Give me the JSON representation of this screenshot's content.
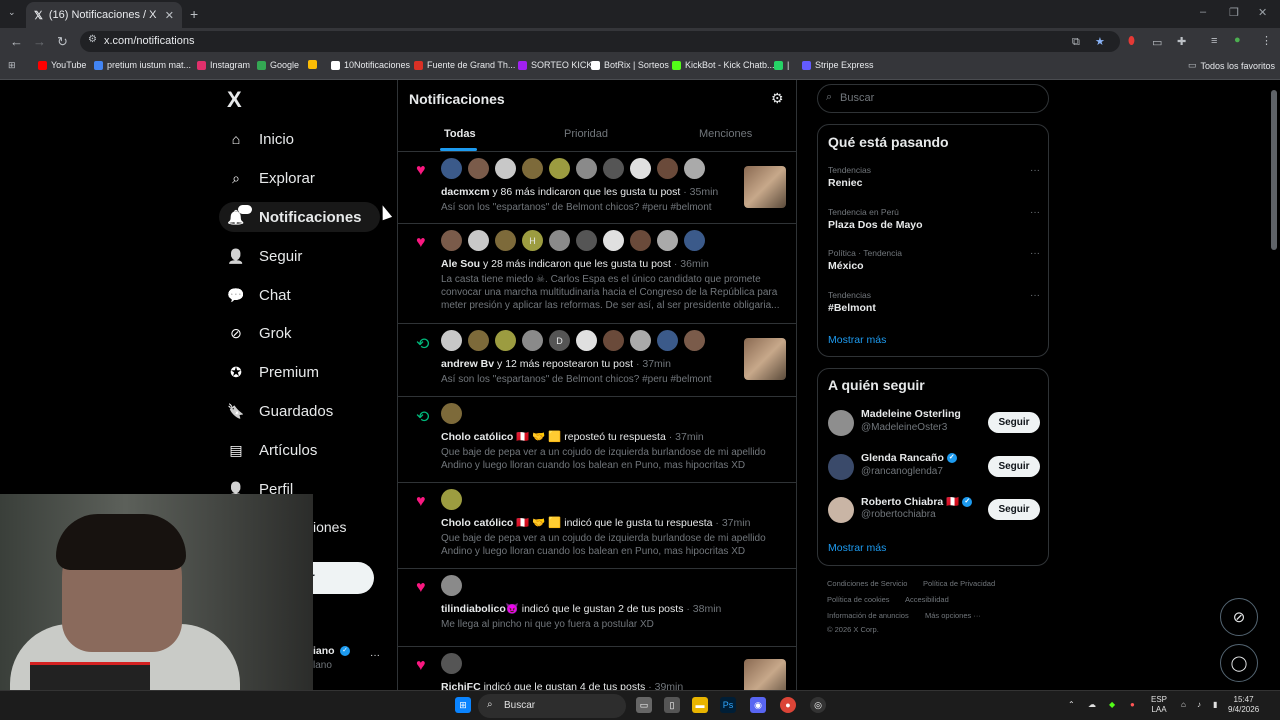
{
  "browser": {
    "tab_title": "(16) Notificaciones / X",
    "url": "x.com/notifications",
    "bookmarks": [
      {
        "label": "YouTube",
        "color": "#ff0000"
      },
      {
        "label": "pretium iustum mat...",
        "color": "#4285f4"
      },
      {
        "label": "Instagram",
        "color": "#e1306c"
      },
      {
        "label": "Google",
        "color": "#34a853"
      },
      {
        "label": "",
        "color": "#fbbc05"
      },
      {
        "label": "10Notificaciones",
        "color": "#ffffff"
      },
      {
        "label": "Fuente de Grand Th...",
        "color": "#d93025"
      },
      {
        "label": "SORTEO KICK",
        "color": "#a020f0"
      },
      {
        "label": "BotRix | Sorteos",
        "color": "#ffffff"
      },
      {
        "label": "KickBot - Kick Chatb...",
        "color": "#53fc18"
      },
      {
        "label": "|",
        "color": "#25d366"
      },
      {
        "label": "Stripe Express",
        "color": "#635bff"
      }
    ],
    "all_bookmarks": "Todos los favoritos"
  },
  "sidebar": {
    "logo": "X",
    "items": [
      {
        "label": "Inicio",
        "icon": "home-icon"
      },
      {
        "label": "Explorar",
        "icon": "search-icon"
      },
      {
        "label": "Notificaciones",
        "icon": "bell-icon",
        "badge": "16"
      },
      {
        "label": "Seguir",
        "icon": "add-person-icon"
      },
      {
        "label": "Chat",
        "icon": "chat-icon"
      },
      {
        "label": "Grok",
        "icon": "grok-icon"
      },
      {
        "label": "Premium",
        "icon": "premium-icon"
      },
      {
        "label": "Guardados",
        "icon": "bookmark-icon"
      },
      {
        "label": "Artículos",
        "icon": "articles-icon"
      },
      {
        "label": "Perfil",
        "icon": "person-icon"
      }
    ],
    "partial_more": "iones",
    "partial_post": "r",
    "partial_name": "iano",
    "partial_handle": "lano",
    "more_dots": "···"
  },
  "main": {
    "title": "Notificaciones",
    "tabs": [
      "Todas",
      "Prioridad",
      "Menciones"
    ],
    "notifications": [
      {
        "kind": "like",
        "avatars": [
          "",
          "",
          "",
          "",
          "",
          "",
          "",
          "",
          "",
          ""
        ],
        "actor": "dacmxcm",
        "action": " y 86 más indicaron que les gusta tu post",
        "time": " · 35min",
        "text": "Así son los \"espartanos\" de Belmont chicos? #peru #belmont",
        "thumb": true
      },
      {
        "kind": "like",
        "avatars": [
          "",
          "",
          "",
          "H",
          "",
          "",
          "",
          "",
          "",
          ""
        ],
        "actor": "Ale Sou",
        "action": " y 28 más indicaron que les gusta tu post",
        "time": " · 36min",
        "text": "La casta tiene miedo ☠. Carlos Espa es el único candidato que promete convocar una marcha multitudinaria hacia el Congreso de la República para meter presión y aplicar las reformas. De ser así, al ser presidente obligaria...",
        "thumb": false
      },
      {
        "kind": "repost",
        "avatars": [
          "",
          "",
          "",
          "",
          "D",
          "",
          "",
          "",
          "",
          ""
        ],
        "actor": "andrew Bv",
        "action": " y 12 más repostearon tu post",
        "time": " · 37min",
        "text": "Así son los \"espartanos\" de Belmont chicos? #peru #belmont",
        "thumb": true
      },
      {
        "kind": "repost",
        "avatars": [
          ""
        ],
        "actor": "Cholo católico",
        "action": " 🇵🇪 🤝 🟨 reposteó tu respuesta",
        "time": " · 37min",
        "text": "Que baje de pepa ver a un cojudo de izquierda burlandose de mi apellido Andino y luego lloran cuando los balean en Puno, mas hipocritas XD",
        "thumb": false
      },
      {
        "kind": "like",
        "avatars": [
          ""
        ],
        "actor": "Cholo católico",
        "action": " 🇵🇪 🤝 🟨 indicó que le gusta tu respuesta",
        "time": " · 37min",
        "text": "Que baje de pepa ver a un cojudo de izquierda burlandose de mi apellido Andino y luego lloran cuando los balean en Puno, mas hipocritas XD",
        "thumb": false
      },
      {
        "kind": "like",
        "avatars": [
          ""
        ],
        "actor": "tilindiabolico😈",
        "action": " indicó que le gustan 2 de tus posts",
        "time": " · 38min",
        "text": "Me llega al pincho ni que yo fuera a postular XD",
        "thumb": false
      },
      {
        "kind": "like",
        "avatars": [
          ""
        ],
        "actor": "RichiFC",
        "action": " indicó que le gustan 4 de tus posts",
        "time": " · 39min",
        "text": "",
        "thumb": true
      }
    ]
  },
  "right": {
    "search_placeholder": "Buscar",
    "trending_title": "Qué está pasando",
    "trends": [
      {
        "context": "Tendencias",
        "name": "Reniec"
      },
      {
        "context": "Tendencia en Perú",
        "name": "Plaza Dos de Mayo"
      },
      {
        "context": "Política · Tendencia",
        "name": "México"
      },
      {
        "context": "Tendencias",
        "name": "#Belmont"
      }
    ],
    "show_more": "Mostrar más",
    "follow_title": "A quién seguir",
    "follow": [
      {
        "name": "Madeleine Osterling",
        "handle": "@MadeleineOster3",
        "verified": false,
        "flag": ""
      },
      {
        "name": "Glenda Rancaño",
        "handle": "@rancanoglenda7",
        "verified": true,
        "flag": ""
      },
      {
        "name": "Roberto Chiabra",
        "handle": "@robertochiabra",
        "verified": true,
        "flag": "🇵🇪"
      }
    ],
    "follow_button": "Seguir",
    "footer": [
      "Condiciones de Servicio",
      "Política de Privacidad",
      "Política de cookies",
      "Accesibilidad",
      "Información de anuncios",
      "Más opciones ···",
      "© 2026 X Corp."
    ]
  },
  "taskbar": {
    "search": "Buscar",
    "lang1": "ESP",
    "lang2": "LAA",
    "time": "15:47",
    "date": "9/4/2026"
  }
}
